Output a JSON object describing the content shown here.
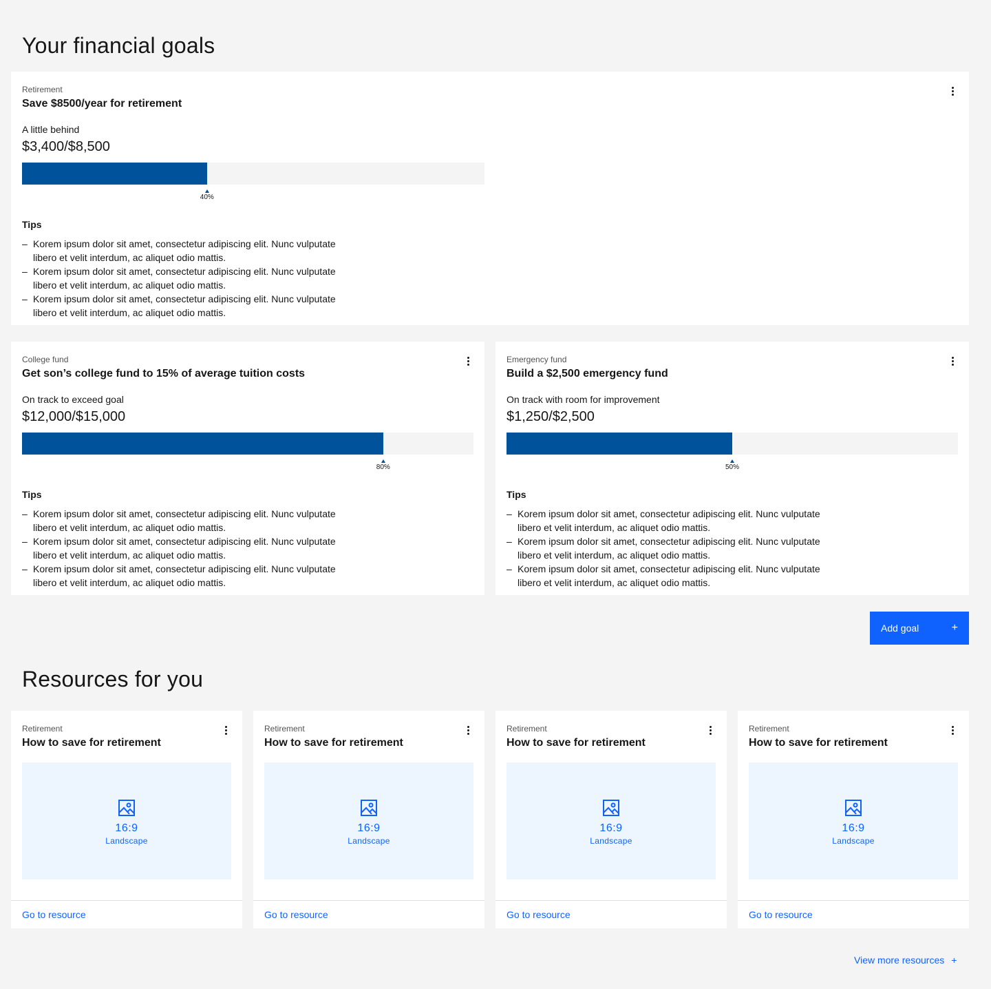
{
  "goals_section": {
    "title": "Your financial goals"
  },
  "goals": [
    {
      "category": "Retirement",
      "title": "Save $8500/year for retirement",
      "status": "A little behind",
      "amount": "$3,400/$8,500",
      "progress": 0.4,
      "progress_label": "40%",
      "tips_title": "Tips",
      "tips": [
        "Korem ipsum dolor sit amet, consectetur adipiscing elit. Nunc vulputate libero et velit interdum, ac aliquet odio mattis.",
        "Korem ipsum dolor sit amet, consectetur adipiscing elit. Nunc vulputate libero et velit interdum, ac aliquet odio mattis.",
        "Korem ipsum dolor sit amet, consectetur adipiscing elit. Nunc vulputate libero et velit interdum, ac aliquet odio mattis."
      ]
    },
    {
      "category": "College fund",
      "title": "Get son’s college fund to 15% of average tuition costs",
      "status": "On track to exceed goal",
      "amount": "$12,000/$15,000",
      "progress": 0.8,
      "progress_label": "80%",
      "tips_title": "Tips",
      "tips": [
        "Korem ipsum dolor sit amet, consectetur adipiscing elit. Nunc vulputate libero et velit interdum, ac aliquet odio mattis.",
        "Korem ipsum dolor sit amet, consectetur adipiscing elit. Nunc vulputate libero et velit interdum, ac aliquet odio mattis.",
        "Korem ipsum dolor sit amet, consectetur adipiscing elit. Nunc vulputate libero et velit interdum, ac aliquet odio mattis."
      ]
    },
    {
      "category": "Emergency fund",
      "title": "Build a $2,500 emergency fund",
      "status": "On track with room for improvement",
      "amount": "$1,250/$2,500",
      "progress": 0.5,
      "progress_label": "50%",
      "tips_title": "Tips",
      "tips": [
        "Korem ipsum dolor sit amet, consectetur adipiscing elit. Nunc vulputate libero et velit interdum, ac aliquet odio mattis.",
        "Korem ipsum dolor sit amet, consectetur adipiscing elit. Nunc vulputate libero et velit interdum, ac aliquet odio mattis.",
        "Korem ipsum dolor sit amet, consectetur adipiscing elit. Nunc vulputate libero et velit interdum, ac aliquet odio mattis."
      ]
    }
  ],
  "add_goal": {
    "label": "Add goal",
    "icon": "plus-icon"
  },
  "resources_section": {
    "title": "Resources for you"
  },
  "resources": [
    {
      "category": "Retirement",
      "title": "How to save for retirement",
      "media_ratio": "16:9",
      "media_label": "Landscape",
      "link": "Go to resource"
    },
    {
      "category": "Retirement",
      "title": "How to save for retirement",
      "media_ratio": "16:9",
      "media_label": "Landscape",
      "link": "Go to resource"
    },
    {
      "category": "Retirement",
      "title": "How to save for retirement",
      "media_ratio": "16:9",
      "media_label": "Landscape",
      "link": "Go to resource"
    },
    {
      "category": "Retirement",
      "title": "How to save for retirement",
      "media_ratio": "16:9",
      "media_label": "Landscape",
      "link": "Go to resource"
    }
  ],
  "view_more": {
    "label": "View more resources",
    "icon": "plus-icon"
  },
  "colors": {
    "accent": "#0f62fe",
    "progress": "#00539a",
    "background": "#f4f4f4",
    "media_bg": "#edf5ff"
  }
}
